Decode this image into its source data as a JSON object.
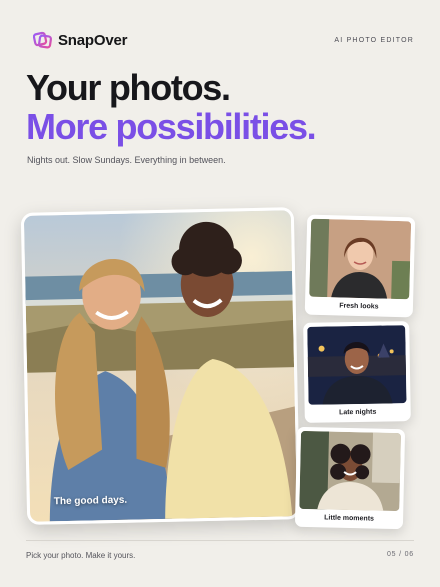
{
  "brand": {
    "name": "SnapOver",
    "tagline": "AI PHOTO EDITOR",
    "accent_color": "#7a4fe6"
  },
  "headline": {
    "line1": "Your photos.",
    "line2": "More possibilities."
  },
  "subheadline": "Nights out. Slow Sundays. Everything in between.",
  "hero": {
    "icon": "two-friends-beach-photo",
    "caption": "The good days."
  },
  "cards": [
    {
      "icon": "portrait-photo",
      "caption": "Fresh looks"
    },
    {
      "icon": "city-night-portrait-photo",
      "caption": "Late nights"
    },
    {
      "icon": "cafe-portrait-photo",
      "caption": "Little moments"
    }
  ],
  "footer": {
    "left": "Pick your photo. Make it yours.",
    "page": "05 / 06"
  }
}
